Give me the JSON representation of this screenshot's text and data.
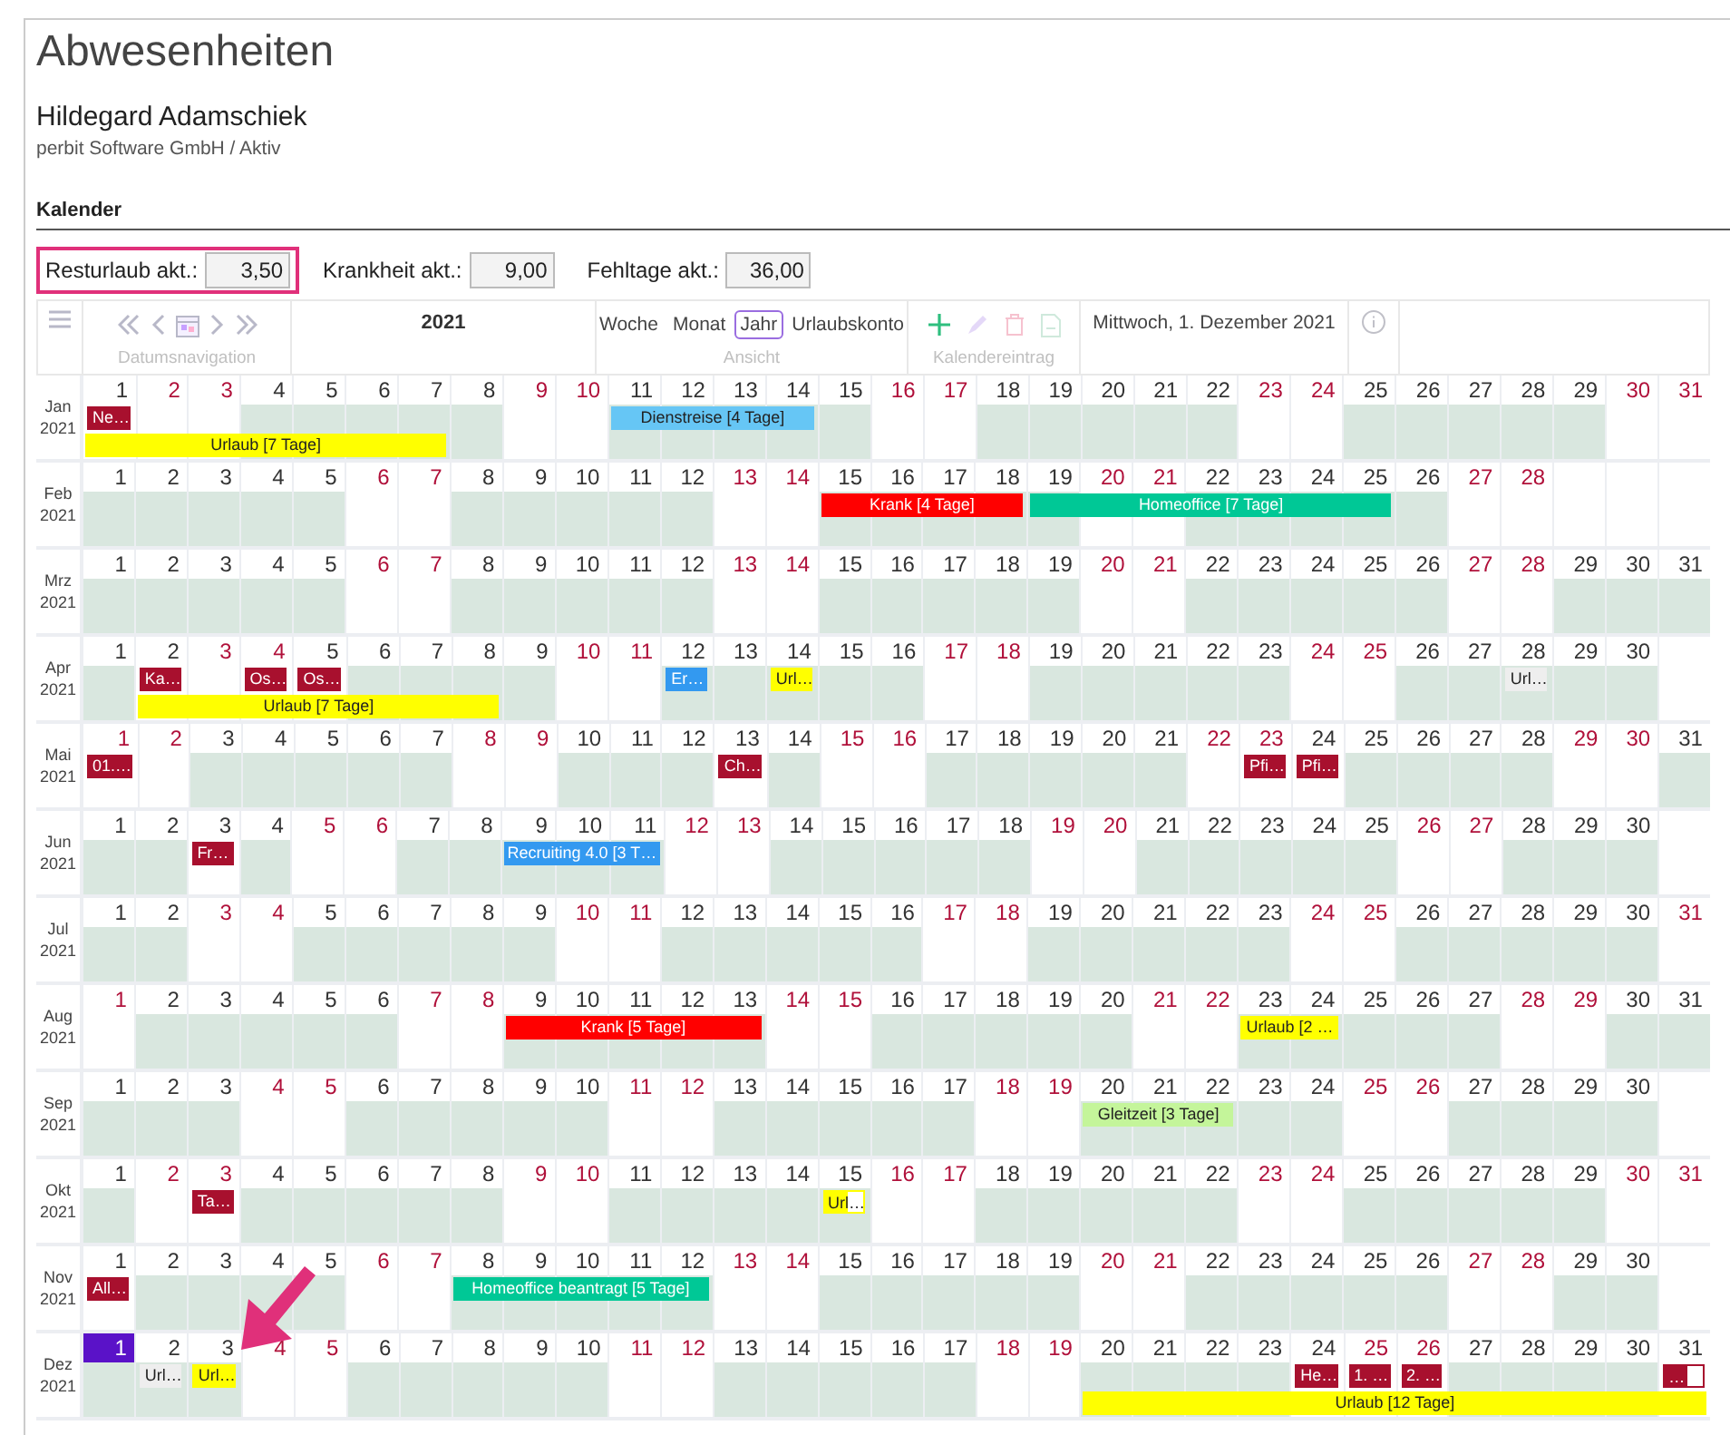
{
  "page": {
    "title": "Abwesenheiten",
    "employee": "Hildegard Adamschiek",
    "organization": "perbit Software GmbH / Aktiv",
    "section": "Kalender"
  },
  "stats": [
    {
      "label": "Resturlaub akt.:",
      "value": "3,50",
      "highlighted": true
    },
    {
      "label": "Krankheit akt.:",
      "value": "9,00",
      "highlighted": false
    },
    {
      "label": "Fehltage akt.:",
      "value": "36,00",
      "highlighted": false
    }
  ],
  "toolbar": {
    "navigation_label": "Datumsnavigation",
    "year": "2021",
    "views": [
      {
        "label": "Woche",
        "selected": false
      },
      {
        "label": "Monat",
        "selected": false
      },
      {
        "label": "Jahr",
        "selected": true
      },
      {
        "label": "Urlaubskonto",
        "selected": false
      }
    ],
    "view_label": "Ansicht",
    "entry_actions": [
      {
        "kind": "add",
        "disabled": false
      },
      {
        "kind": "edit",
        "disabled": true
      },
      {
        "kind": "delete",
        "disabled": true
      },
      {
        "kind": "export",
        "disabled": true
      }
    ],
    "entry_label": "Kalendereintrag",
    "date": "Mittwoch, 1. Dezember 2021"
  },
  "calendar": {
    "months": [
      {
        "month": "Jan",
        "year": "2021",
        "days": [
          {
            "day": "1",
            "kind": "holiday",
            "entries": [
              {
                "label": "Ne…",
                "kind": "marker",
                "color": "#a8102e"
              },
              {
                "label": "Urlaub [7 Tage]",
                "kind": "bar",
                "color": "#ffff00"
              }
            ]
          },
          {
            "day": "2",
            "kind": "weekend"
          },
          {
            "day": "3",
            "kind": "weekend"
          },
          {
            "day": "4",
            "kind": "work"
          },
          {
            "day": "5",
            "kind": "work"
          },
          {
            "day": "6",
            "kind": "work"
          },
          {
            "day": "7",
            "kind": "work"
          },
          {
            "day": "8",
            "kind": "work"
          },
          {
            "day": "9",
            "kind": "weekend"
          },
          {
            "day": "10",
            "kind": "weekend"
          },
          {
            "day": "11",
            "kind": "work",
            "entries": [
              {
                "label": "Dienstreise [4 Tage]",
                "kind": "bar",
                "color": "#66c6f5"
              }
            ]
          },
          {
            "day": "12",
            "kind": "work"
          },
          {
            "day": "13",
            "kind": "work"
          },
          {
            "day": "14",
            "kind": "work"
          },
          {
            "day": "15",
            "kind": "work"
          },
          {
            "day": "16",
            "kind": "weekend"
          },
          {
            "day": "17",
            "kind": "weekend"
          },
          {
            "day": "18",
            "kind": "work"
          },
          {
            "day": "19",
            "kind": "work"
          },
          {
            "day": "20",
            "kind": "work"
          },
          {
            "day": "21",
            "kind": "work"
          },
          {
            "day": "22",
            "kind": "work"
          },
          {
            "day": "23",
            "kind": "weekend"
          },
          {
            "day": "24",
            "kind": "weekend"
          },
          {
            "day": "25",
            "kind": "work"
          },
          {
            "day": "26",
            "kind": "work"
          },
          {
            "day": "27",
            "kind": "work"
          },
          {
            "day": "28",
            "kind": "work"
          },
          {
            "day": "29",
            "kind": "work"
          },
          {
            "day": "30",
            "kind": "weekend"
          },
          {
            "day": "31",
            "kind": "weekend"
          }
        ]
      },
      {
        "month": "Feb",
        "year": "2021",
        "days": [
          {
            "day": "1",
            "kind": "work"
          },
          {
            "day": "2",
            "kind": "work"
          },
          {
            "day": "3",
            "kind": "work"
          },
          {
            "day": "4",
            "kind": "work"
          },
          {
            "day": "5",
            "kind": "work"
          },
          {
            "day": "6",
            "kind": "weekend"
          },
          {
            "day": "7",
            "kind": "weekend"
          },
          {
            "day": "8",
            "kind": "work"
          },
          {
            "day": "9",
            "kind": "work"
          },
          {
            "day": "10",
            "kind": "work"
          },
          {
            "day": "11",
            "kind": "work"
          },
          {
            "day": "12",
            "kind": "work"
          },
          {
            "day": "13",
            "kind": "weekend"
          },
          {
            "day": "14",
            "kind": "weekend"
          },
          {
            "day": "15",
            "kind": "work",
            "entries": [
              {
                "label": "Krank [4 Tage]",
                "kind": "bar",
                "color": "#ff0000"
              }
            ]
          },
          {
            "day": "16",
            "kind": "work"
          },
          {
            "day": "17",
            "kind": "work"
          },
          {
            "day": "18",
            "kind": "work"
          },
          {
            "day": "19",
            "kind": "work",
            "entries": [
              {
                "label": "Homeoffice [7 Tage]",
                "kind": "bar",
                "color": "#00c896"
              }
            ]
          },
          {
            "day": "20",
            "kind": "weekend"
          },
          {
            "day": "21",
            "kind": "weekend"
          },
          {
            "day": "22",
            "kind": "work"
          },
          {
            "day": "23",
            "kind": "work"
          },
          {
            "day": "24",
            "kind": "work"
          },
          {
            "day": "25",
            "kind": "work"
          },
          {
            "day": "26",
            "kind": "work"
          },
          {
            "day": "27",
            "kind": "weekend"
          },
          {
            "day": "28",
            "kind": "weekend"
          }
        ]
      },
      {
        "month": "Mrz",
        "year": "2021",
        "days": [
          {
            "day": "1",
            "kind": "work"
          },
          {
            "day": "2",
            "kind": "work"
          },
          {
            "day": "3",
            "kind": "work"
          },
          {
            "day": "4",
            "kind": "work"
          },
          {
            "day": "5",
            "kind": "work"
          },
          {
            "day": "6",
            "kind": "weekend"
          },
          {
            "day": "7",
            "kind": "weekend"
          },
          {
            "day": "8",
            "kind": "work"
          },
          {
            "day": "9",
            "kind": "work"
          },
          {
            "day": "10",
            "kind": "work"
          },
          {
            "day": "11",
            "kind": "work"
          },
          {
            "day": "12",
            "kind": "work"
          },
          {
            "day": "13",
            "kind": "weekend"
          },
          {
            "day": "14",
            "kind": "weekend"
          },
          {
            "day": "15",
            "kind": "work"
          },
          {
            "day": "16",
            "kind": "work"
          },
          {
            "day": "17",
            "kind": "work"
          },
          {
            "day": "18",
            "kind": "work"
          },
          {
            "day": "19",
            "kind": "work"
          },
          {
            "day": "20",
            "kind": "weekend"
          },
          {
            "day": "21",
            "kind": "weekend"
          },
          {
            "day": "22",
            "kind": "work"
          },
          {
            "day": "23",
            "kind": "work"
          },
          {
            "day": "24",
            "kind": "work"
          },
          {
            "day": "25",
            "kind": "work"
          },
          {
            "day": "26",
            "kind": "work"
          },
          {
            "day": "27",
            "kind": "weekend"
          },
          {
            "day": "28",
            "kind": "weekend"
          },
          {
            "day": "29",
            "kind": "work"
          },
          {
            "day": "30",
            "kind": "work"
          },
          {
            "day": "31",
            "kind": "work"
          }
        ]
      },
      {
        "month": "Apr",
        "year": "2021",
        "days": [
          {
            "day": "1",
            "kind": "work"
          },
          {
            "day": "2",
            "kind": "holiday",
            "entries": [
              {
                "label": "Ka…",
                "kind": "marker",
                "color": "#a8102e"
              },
              {
                "label": "Urlaub [7 Tage]",
                "kind": "bar",
                "color": "#ffff00"
              }
            ]
          },
          {
            "day": "3",
            "kind": "weekend"
          },
          {
            "day": "4",
            "kind": "weekend",
            "entries": [
              {
                "label": "Os…",
                "kind": "marker",
                "color": "#a8102e"
              }
            ]
          },
          {
            "day": "5",
            "kind": "holiday",
            "entries": [
              {
                "label": "Os…",
                "kind": "marker",
                "color": "#a8102e"
              }
            ]
          },
          {
            "day": "6",
            "kind": "work"
          },
          {
            "day": "7",
            "kind": "work"
          },
          {
            "day": "8",
            "kind": "work"
          },
          {
            "day": "9",
            "kind": "work"
          },
          {
            "day": "10",
            "kind": "weekend"
          },
          {
            "day": "11",
            "kind": "weekend"
          },
          {
            "day": "12",
            "kind": "work",
            "entries": [
              {
                "label": "Er…",
                "kind": "marker",
                "color": "#3399f0"
              }
            ]
          },
          {
            "day": "13",
            "kind": "work"
          },
          {
            "day": "14",
            "kind": "work",
            "entries": [
              {
                "label": "Url…",
                "kind": "marker",
                "color": "#ffff00"
              }
            ]
          },
          {
            "day": "15",
            "kind": "work"
          },
          {
            "day": "16",
            "kind": "work"
          },
          {
            "day": "17",
            "kind": "weekend"
          },
          {
            "day": "18",
            "kind": "weekend"
          },
          {
            "day": "19",
            "kind": "work"
          },
          {
            "day": "20",
            "kind": "work"
          },
          {
            "day": "21",
            "kind": "work"
          },
          {
            "day": "22",
            "kind": "work"
          },
          {
            "day": "23",
            "kind": "work"
          },
          {
            "day": "24",
            "kind": "weekend"
          },
          {
            "day": "25",
            "kind": "weekend"
          },
          {
            "day": "26",
            "kind": "work"
          },
          {
            "day": "27",
            "kind": "work"
          },
          {
            "day": "28",
            "kind": "work",
            "entries": [
              {
                "label": "Url…",
                "kind": "marker",
                "color": "#eeeeee"
              }
            ]
          },
          {
            "day": "29",
            "kind": "work"
          },
          {
            "day": "30",
            "kind": "work"
          }
        ]
      },
      {
        "month": "Mai",
        "year": "2021",
        "days": [
          {
            "day": "1",
            "kind": "weekend",
            "entries": [
              {
                "label": "01.…",
                "kind": "marker",
                "color": "#a8102e"
              }
            ]
          },
          {
            "day": "2",
            "kind": "weekend"
          },
          {
            "day": "3",
            "kind": "work"
          },
          {
            "day": "4",
            "kind": "work"
          },
          {
            "day": "5",
            "kind": "work"
          },
          {
            "day": "6",
            "kind": "work"
          },
          {
            "day": "7",
            "kind": "work"
          },
          {
            "day": "8",
            "kind": "weekend"
          },
          {
            "day": "9",
            "kind": "weekend"
          },
          {
            "day": "10",
            "kind": "work"
          },
          {
            "day": "11",
            "kind": "work"
          },
          {
            "day": "12",
            "kind": "work"
          },
          {
            "day": "13",
            "kind": "holiday",
            "entries": [
              {
                "label": "Ch…",
                "kind": "marker",
                "color": "#a8102e"
              }
            ]
          },
          {
            "day": "14",
            "kind": "work"
          },
          {
            "day": "15",
            "kind": "weekend"
          },
          {
            "day": "16",
            "kind": "weekend"
          },
          {
            "day": "17",
            "kind": "work"
          },
          {
            "day": "18",
            "kind": "work"
          },
          {
            "day": "19",
            "kind": "work"
          },
          {
            "day": "20",
            "kind": "work"
          },
          {
            "day": "21",
            "kind": "work"
          },
          {
            "day": "22",
            "kind": "weekend"
          },
          {
            "day": "23",
            "kind": "weekend",
            "entries": [
              {
                "label": "Pfi…",
                "kind": "marker",
                "color": "#a8102e"
              }
            ]
          },
          {
            "day": "24",
            "kind": "holiday",
            "entries": [
              {
                "label": "Pfi…",
                "kind": "marker",
                "color": "#a8102e"
              }
            ]
          },
          {
            "day": "25",
            "kind": "work"
          },
          {
            "day": "26",
            "kind": "work"
          },
          {
            "day": "27",
            "kind": "work"
          },
          {
            "day": "28",
            "kind": "work"
          },
          {
            "day": "29",
            "kind": "weekend"
          },
          {
            "day": "30",
            "kind": "weekend"
          },
          {
            "day": "31",
            "kind": "work"
          }
        ]
      },
      {
        "month": "Jun",
        "year": "2021",
        "days": [
          {
            "day": "1",
            "kind": "work"
          },
          {
            "day": "2",
            "kind": "work"
          },
          {
            "day": "3",
            "kind": "holiday",
            "entries": [
              {
                "label": "Fr…",
                "kind": "marker",
                "color": "#a8102e"
              }
            ]
          },
          {
            "day": "4",
            "kind": "work"
          },
          {
            "day": "5",
            "kind": "weekend"
          },
          {
            "day": "6",
            "kind": "weekend"
          },
          {
            "day": "7",
            "kind": "work"
          },
          {
            "day": "8",
            "kind": "work"
          },
          {
            "day": "9",
            "kind": "work",
            "entries": [
              {
                "label": "Recruiting 4.0 [3 T…",
                "kind": "bar",
                "color": "#3399f0"
              }
            ]
          },
          {
            "day": "10",
            "kind": "work"
          },
          {
            "day": "11",
            "kind": "work"
          },
          {
            "day": "12",
            "kind": "weekend"
          },
          {
            "day": "13",
            "kind": "weekend"
          },
          {
            "day": "14",
            "kind": "work"
          },
          {
            "day": "15",
            "kind": "work"
          },
          {
            "day": "16",
            "kind": "work"
          },
          {
            "day": "17",
            "kind": "work"
          },
          {
            "day": "18",
            "kind": "work"
          },
          {
            "day": "19",
            "kind": "weekend"
          },
          {
            "day": "20",
            "kind": "weekend"
          },
          {
            "day": "21",
            "kind": "work"
          },
          {
            "day": "22",
            "kind": "work"
          },
          {
            "day": "23",
            "kind": "work"
          },
          {
            "day": "24",
            "kind": "work"
          },
          {
            "day": "25",
            "kind": "work"
          },
          {
            "day": "26",
            "kind": "weekend"
          },
          {
            "day": "27",
            "kind": "weekend"
          },
          {
            "day": "28",
            "kind": "work"
          },
          {
            "day": "29",
            "kind": "work"
          },
          {
            "day": "30",
            "kind": "work"
          }
        ]
      },
      {
        "month": "Jul",
        "year": "2021",
        "days": [
          {
            "day": "1",
            "kind": "work"
          },
          {
            "day": "2",
            "kind": "work"
          },
          {
            "day": "3",
            "kind": "weekend"
          },
          {
            "day": "4",
            "kind": "weekend"
          },
          {
            "day": "5",
            "kind": "work"
          },
          {
            "day": "6",
            "kind": "work"
          },
          {
            "day": "7",
            "kind": "work"
          },
          {
            "day": "8",
            "kind": "work"
          },
          {
            "day": "9",
            "kind": "work"
          },
          {
            "day": "10",
            "kind": "weekend"
          },
          {
            "day": "11",
            "kind": "weekend"
          },
          {
            "day": "12",
            "kind": "work"
          },
          {
            "day": "13",
            "kind": "work"
          },
          {
            "day": "14",
            "kind": "work"
          },
          {
            "day": "15",
            "kind": "work"
          },
          {
            "day": "16",
            "kind": "work"
          },
          {
            "day": "17",
            "kind": "weekend"
          },
          {
            "day": "18",
            "kind": "weekend"
          },
          {
            "day": "19",
            "kind": "work"
          },
          {
            "day": "20",
            "kind": "work"
          },
          {
            "day": "21",
            "kind": "work"
          },
          {
            "day": "22",
            "kind": "work"
          },
          {
            "day": "23",
            "kind": "work"
          },
          {
            "day": "24",
            "kind": "weekend"
          },
          {
            "day": "25",
            "kind": "weekend"
          },
          {
            "day": "26",
            "kind": "work"
          },
          {
            "day": "27",
            "kind": "work"
          },
          {
            "day": "28",
            "kind": "work"
          },
          {
            "day": "29",
            "kind": "work"
          },
          {
            "day": "30",
            "kind": "work"
          },
          {
            "day": "31",
            "kind": "weekend"
          }
        ]
      },
      {
        "month": "Aug",
        "year": "2021",
        "days": [
          {
            "day": "1",
            "kind": "weekend"
          },
          {
            "day": "2",
            "kind": "work"
          },
          {
            "day": "3",
            "kind": "work"
          },
          {
            "day": "4",
            "kind": "work"
          },
          {
            "day": "5",
            "kind": "work"
          },
          {
            "day": "6",
            "kind": "work"
          },
          {
            "day": "7",
            "kind": "weekend"
          },
          {
            "day": "8",
            "kind": "weekend"
          },
          {
            "day": "9",
            "kind": "work",
            "entries": [
              {
                "label": "Krank [5 Tage]",
                "kind": "bar",
                "color": "#ff0000"
              }
            ]
          },
          {
            "day": "10",
            "kind": "work"
          },
          {
            "day": "11",
            "kind": "work"
          },
          {
            "day": "12",
            "kind": "work"
          },
          {
            "day": "13",
            "kind": "work"
          },
          {
            "day": "14",
            "kind": "weekend"
          },
          {
            "day": "15",
            "kind": "weekend"
          },
          {
            "day": "16",
            "kind": "work"
          },
          {
            "day": "17",
            "kind": "work"
          },
          {
            "day": "18",
            "kind": "work"
          },
          {
            "day": "19",
            "kind": "work"
          },
          {
            "day": "20",
            "kind": "work"
          },
          {
            "day": "21",
            "kind": "weekend"
          },
          {
            "day": "22",
            "kind": "weekend"
          },
          {
            "day": "23",
            "kind": "work",
            "entries": [
              {
                "label": "Urlaub [2 …",
                "kind": "bar",
                "color": "#ffff00"
              }
            ]
          },
          {
            "day": "24",
            "kind": "work"
          },
          {
            "day": "25",
            "kind": "work"
          },
          {
            "day": "26",
            "kind": "work"
          },
          {
            "day": "27",
            "kind": "work"
          },
          {
            "day": "28",
            "kind": "weekend"
          },
          {
            "day": "29",
            "kind": "weekend"
          },
          {
            "day": "30",
            "kind": "work"
          },
          {
            "day": "31",
            "kind": "work"
          }
        ]
      },
      {
        "month": "Sep",
        "year": "2021",
        "days": [
          {
            "day": "1",
            "kind": "work"
          },
          {
            "day": "2",
            "kind": "work"
          },
          {
            "day": "3",
            "kind": "work"
          },
          {
            "day": "4",
            "kind": "weekend"
          },
          {
            "day": "5",
            "kind": "weekend"
          },
          {
            "day": "6",
            "kind": "work"
          },
          {
            "day": "7",
            "kind": "work"
          },
          {
            "day": "8",
            "kind": "work"
          },
          {
            "day": "9",
            "kind": "work"
          },
          {
            "day": "10",
            "kind": "work"
          },
          {
            "day": "11",
            "kind": "weekend"
          },
          {
            "day": "12",
            "kind": "weekend"
          },
          {
            "day": "13",
            "kind": "work"
          },
          {
            "day": "14",
            "kind": "work"
          },
          {
            "day": "15",
            "kind": "work"
          },
          {
            "day": "16",
            "kind": "work"
          },
          {
            "day": "17",
            "kind": "work"
          },
          {
            "day": "18",
            "kind": "weekend"
          },
          {
            "day": "19",
            "kind": "weekend"
          },
          {
            "day": "20",
            "kind": "work",
            "entries": [
              {
                "label": "Gleitzeit [3 Tage]",
                "kind": "bar",
                "color": "#c4f59a"
              }
            ]
          },
          {
            "day": "21",
            "kind": "work"
          },
          {
            "day": "22",
            "kind": "work"
          },
          {
            "day": "23",
            "kind": "work"
          },
          {
            "day": "24",
            "kind": "work"
          },
          {
            "day": "25",
            "kind": "weekend"
          },
          {
            "day": "26",
            "kind": "weekend"
          },
          {
            "day": "27",
            "kind": "work"
          },
          {
            "day": "28",
            "kind": "work"
          },
          {
            "day": "29",
            "kind": "work"
          },
          {
            "day": "30",
            "kind": "work"
          }
        ]
      },
      {
        "month": "Okt",
        "year": "2021",
        "days": [
          {
            "day": "1",
            "kind": "work"
          },
          {
            "day": "2",
            "kind": "weekend"
          },
          {
            "day": "3",
            "kind": "weekend",
            "entries": [
              {
                "label": "Ta…",
                "kind": "marker",
                "color": "#a8102e"
              }
            ]
          },
          {
            "day": "4",
            "kind": "work"
          },
          {
            "day": "5",
            "kind": "work"
          },
          {
            "day": "6",
            "kind": "work"
          },
          {
            "day": "7",
            "kind": "work"
          },
          {
            "day": "8",
            "kind": "work"
          },
          {
            "day": "9",
            "kind": "weekend"
          },
          {
            "day": "10",
            "kind": "weekend"
          },
          {
            "day": "11",
            "kind": "work"
          },
          {
            "day": "12",
            "kind": "work"
          },
          {
            "day": "13",
            "kind": "work"
          },
          {
            "day": "14",
            "kind": "work"
          },
          {
            "day": "15",
            "kind": "work",
            "entries": [
              {
                "label": "Url…",
                "kind": "half",
                "color": "#ffff00"
              }
            ]
          },
          {
            "day": "16",
            "kind": "weekend"
          },
          {
            "day": "17",
            "kind": "weekend"
          },
          {
            "day": "18",
            "kind": "work"
          },
          {
            "day": "19",
            "kind": "work"
          },
          {
            "day": "20",
            "kind": "work"
          },
          {
            "day": "21",
            "kind": "work"
          },
          {
            "day": "22",
            "kind": "work"
          },
          {
            "day": "23",
            "kind": "weekend"
          },
          {
            "day": "24",
            "kind": "weekend"
          },
          {
            "day": "25",
            "kind": "work"
          },
          {
            "day": "26",
            "kind": "work"
          },
          {
            "day": "27",
            "kind": "work"
          },
          {
            "day": "28",
            "kind": "work"
          },
          {
            "day": "29",
            "kind": "work"
          },
          {
            "day": "30",
            "kind": "weekend"
          },
          {
            "day": "31",
            "kind": "weekend"
          }
        ]
      },
      {
        "month": "Nov",
        "year": "2021",
        "days": [
          {
            "day": "1",
            "kind": "holiday",
            "entries": [
              {
                "label": "All…",
                "kind": "marker",
                "color": "#a8102e"
              }
            ]
          },
          {
            "day": "2",
            "kind": "work"
          },
          {
            "day": "3",
            "kind": "work"
          },
          {
            "day": "4",
            "kind": "work"
          },
          {
            "day": "5",
            "kind": "work"
          },
          {
            "day": "6",
            "kind": "weekend"
          },
          {
            "day": "7",
            "kind": "weekend"
          },
          {
            "day": "8",
            "kind": "work",
            "entries": [
              {
                "label": "Homeoffice beantragt [5 Tage]",
                "kind": "bar",
                "color": "#00c896"
              }
            ]
          },
          {
            "day": "9",
            "kind": "work"
          },
          {
            "day": "10",
            "kind": "work"
          },
          {
            "day": "11",
            "kind": "work"
          },
          {
            "day": "12",
            "kind": "work"
          },
          {
            "day": "13",
            "kind": "weekend"
          },
          {
            "day": "14",
            "kind": "weekend"
          },
          {
            "day": "15",
            "kind": "work"
          },
          {
            "day": "16",
            "kind": "work"
          },
          {
            "day": "17",
            "kind": "work"
          },
          {
            "day": "18",
            "kind": "work"
          },
          {
            "day": "19",
            "kind": "work"
          },
          {
            "day": "20",
            "kind": "weekend"
          },
          {
            "day": "21",
            "kind": "weekend"
          },
          {
            "day": "22",
            "kind": "work"
          },
          {
            "day": "23",
            "kind": "work"
          },
          {
            "day": "24",
            "kind": "work"
          },
          {
            "day": "25",
            "kind": "work"
          },
          {
            "day": "26",
            "kind": "work"
          },
          {
            "day": "27",
            "kind": "weekend"
          },
          {
            "day": "28",
            "kind": "weekend"
          },
          {
            "day": "29",
            "kind": "work"
          },
          {
            "day": "30",
            "kind": "work"
          }
        ]
      },
      {
        "month": "Dez",
        "year": "2021",
        "days": [
          {
            "day": "1",
            "kind": "today"
          },
          {
            "day": "2",
            "kind": "work",
            "entries": [
              {
                "label": "Url…",
                "kind": "marker",
                "color": "#eeeeee"
              }
            ]
          },
          {
            "day": "3",
            "kind": "work",
            "entries": [
              {
                "label": "Url…",
                "kind": "marker",
                "color": "#ffff00"
              }
            ]
          },
          {
            "day": "4",
            "kind": "weekend"
          },
          {
            "day": "5",
            "kind": "weekend"
          },
          {
            "day": "6",
            "kind": "work"
          },
          {
            "day": "7",
            "kind": "work"
          },
          {
            "day": "8",
            "kind": "work"
          },
          {
            "day": "9",
            "kind": "work"
          },
          {
            "day": "10",
            "kind": "work"
          },
          {
            "day": "11",
            "kind": "weekend"
          },
          {
            "day": "12",
            "kind": "weekend"
          },
          {
            "day": "13",
            "kind": "work"
          },
          {
            "day": "14",
            "kind": "work"
          },
          {
            "day": "15",
            "kind": "work"
          },
          {
            "day": "16",
            "kind": "work"
          },
          {
            "day": "17",
            "kind": "work"
          },
          {
            "day": "18",
            "kind": "weekend"
          },
          {
            "day": "19",
            "kind": "weekend"
          },
          {
            "day": "20",
            "kind": "work",
            "entries": [
              {
                "label": "Urlaub [12 Tage]",
                "kind": "bar",
                "color": "#ffff00"
              }
            ]
          },
          {
            "day": "21",
            "kind": "work"
          },
          {
            "day": "22",
            "kind": "work"
          },
          {
            "day": "23",
            "kind": "work"
          },
          {
            "day": "24",
            "kind": "holiday",
            "entries": [
              {
                "label": "He…",
                "kind": "marker",
                "color": "#a8102e"
              }
            ]
          },
          {
            "day": "25",
            "kind": "weekend",
            "entries": [
              {
                "label": "1. …",
                "kind": "marker",
                "color": "#a8102e"
              }
            ]
          },
          {
            "day": "26",
            "kind": "weekend",
            "entries": [
              {
                "label": "2. …",
                "kind": "marker",
                "color": "#a8102e"
              }
            ]
          },
          {
            "day": "27",
            "kind": "work"
          },
          {
            "day": "28",
            "kind": "work"
          },
          {
            "day": "29",
            "kind": "work"
          },
          {
            "day": "30",
            "kind": "work"
          },
          {
            "day": "31",
            "kind": "holiday",
            "entries": [
              {
                "label": "…",
                "kind": "half",
                "color": "#a8102e"
              }
            ]
          }
        ]
      }
    ]
  },
  "annotation_arrow": true
}
